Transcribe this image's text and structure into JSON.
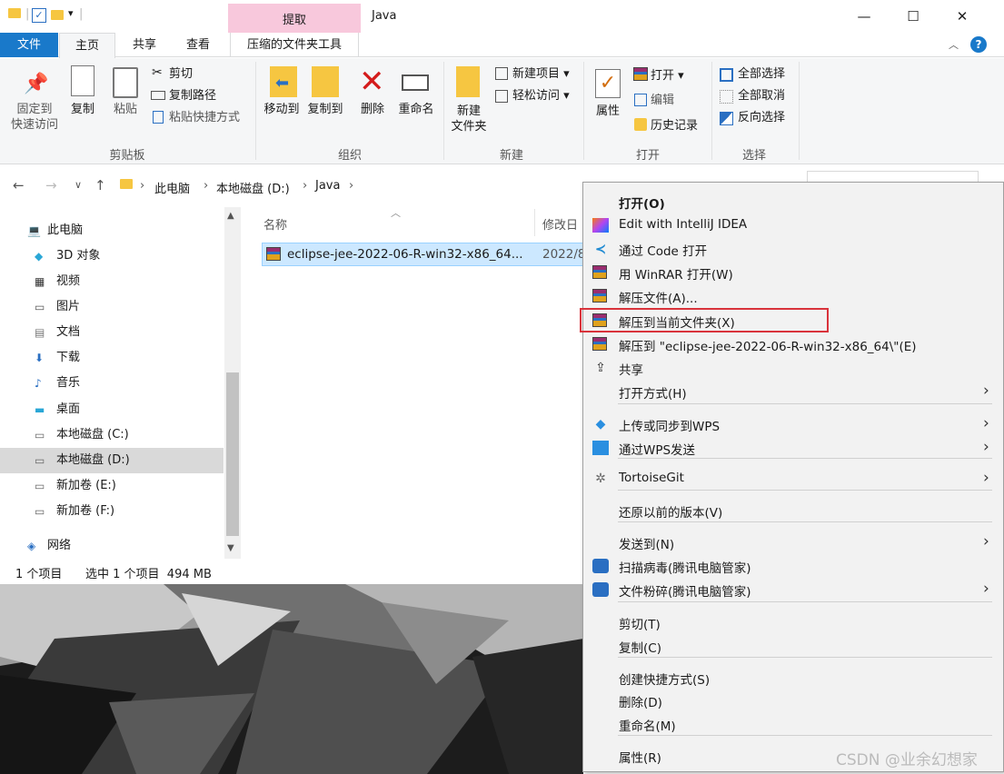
{
  "window": {
    "title": "Java",
    "context_tab_label": "提取",
    "buttons": {
      "minimize": "—",
      "maximize": "☐",
      "close": "✕"
    }
  },
  "ribbon_tabs": {
    "file": "文件",
    "home": "主页",
    "share": "共享",
    "view": "查看",
    "compressed_tools": "压缩的文件夹工具"
  },
  "ribbon": {
    "clipboard": {
      "pin_label": "固定到\n快速访问",
      "copy_label": "复制",
      "paste_label": "粘贴",
      "cut_label": "剪切",
      "copy_path_label": "复制路径",
      "paste_shortcut_label": "粘贴快捷方式",
      "group_label": "剪贴板"
    },
    "organize": {
      "move_to_label": "移动到",
      "copy_to_label": "复制到",
      "delete_label": "删除",
      "rename_label": "重命名",
      "group_label": "组织"
    },
    "new": {
      "new_folder_label": "新建\n文件夹",
      "new_item_label": "新建项目 ▾",
      "easy_access_label": "轻松访问 ▾",
      "group_label": "新建"
    },
    "open": {
      "properties_label": "属性",
      "open_label": "打开 ▾",
      "edit_label": "编辑",
      "history_label": "历史记录",
      "group_label": "打开"
    },
    "select": {
      "select_all_label": "全部选择",
      "select_none_label": "全部取消",
      "invert_label": "反向选择",
      "group_label": "选择"
    }
  },
  "address": {
    "crumbs": [
      "此电脑",
      "本地磁盘 (D:)",
      "Java"
    ],
    "separator": "›"
  },
  "tree": {
    "items": [
      {
        "label": "此电脑",
        "icon": "pc-icon",
        "selected": false
      },
      {
        "label": "3D 对象",
        "icon": "cube-icon",
        "selected": false
      },
      {
        "label": "视频",
        "icon": "video-icon",
        "selected": false
      },
      {
        "label": "图片",
        "icon": "picture-icon",
        "selected": false
      },
      {
        "label": "文档",
        "icon": "document-icon",
        "selected": false
      },
      {
        "label": "下载",
        "icon": "download-icon",
        "selected": false
      },
      {
        "label": "音乐",
        "icon": "music-icon",
        "selected": false
      },
      {
        "label": "桌面",
        "icon": "desktop-icon",
        "selected": false
      },
      {
        "label": "本地磁盘 (C:)",
        "icon": "drive-icon",
        "selected": false
      },
      {
        "label": "本地磁盘 (D:)",
        "icon": "drive-icon",
        "selected": true
      },
      {
        "label": "新加卷 (E:)",
        "icon": "drive-icon",
        "selected": false
      },
      {
        "label": "新加卷 (F:)",
        "icon": "drive-icon",
        "selected": false
      },
      {
        "label": "网络",
        "icon": "network-icon",
        "selected": false
      }
    ]
  },
  "files": {
    "headers": {
      "name": "名称",
      "date": "修改日"
    },
    "rows": [
      {
        "name": "eclipse-jee-2022-06-R-win32-x86_64...",
        "date": "2022/8"
      }
    ]
  },
  "status": {
    "count": "1 个项目",
    "selected": "选中 1 个项目  494 MB"
  },
  "context_menu": {
    "items": [
      {
        "label": "打开(O)",
        "bold": true,
        "icon": ""
      },
      {
        "label": "Edit with IntelliJ IDEA",
        "icon": "intellij-icon"
      },
      {
        "label": "通过 Code 打开",
        "icon": "vscode-icon"
      },
      {
        "label": "用 WinRAR 打开(W)",
        "icon": "winrar-icon"
      },
      {
        "label": "解压文件(A)...",
        "icon": "winrar-icon"
      },
      {
        "label": "解压到当前文件夹(X)",
        "icon": "winrar-icon",
        "highlighted": true
      },
      {
        "label": "解压到 \"eclipse-jee-2022-06-R-win32-x86_64\\\"(E)",
        "icon": "winrar-icon"
      },
      {
        "label": "共享",
        "icon": "share-icon"
      },
      {
        "label": "打开方式(H)",
        "icon": "",
        "submenu": true
      },
      {
        "label": "上传或同步到WPS",
        "icon": "wps-upload-icon",
        "submenu": true
      },
      {
        "label": "通过WPS发送",
        "icon": "wps-send-icon",
        "submenu": true
      },
      {
        "label": "TortoiseGit",
        "icon": "tortoisegit-icon",
        "submenu": true
      },
      {
        "label": "还原以前的版本(V)",
        "icon": ""
      },
      {
        "label": "发送到(N)",
        "icon": "",
        "submenu": true
      },
      {
        "label": "扫描病毒(腾讯电脑管家)",
        "icon": "tencent-shield-icon"
      },
      {
        "label": "文件粉碎(腾讯电脑管家)",
        "icon": "tencent-shield-icon",
        "submenu": true
      },
      {
        "label": "剪切(T)",
        "icon": ""
      },
      {
        "label": "复制(C)",
        "icon": ""
      },
      {
        "label": "创建快捷方式(S)",
        "icon": ""
      },
      {
        "label": "删除(D)",
        "icon": ""
      },
      {
        "label": "重命名(M)",
        "icon": ""
      },
      {
        "label": "属性(R)",
        "icon": ""
      }
    ]
  },
  "watermark": "CSDN @业余幻想家",
  "colors": {
    "accent": "#1979ca",
    "selection": "#cce8ff",
    "highlight_box": "#d9333b",
    "context_tab": "#f8c8dc"
  }
}
